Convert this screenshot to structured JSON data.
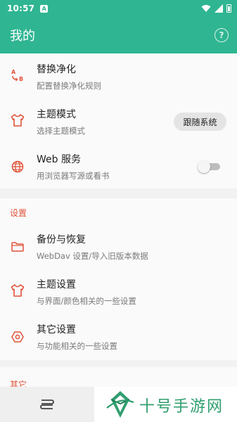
{
  "status_bar": {
    "time": "10:57",
    "notification_badge": "A"
  },
  "app_bar": {
    "title": "我的",
    "help_icon": "question-circle-icon"
  },
  "colors": {
    "primary": "#2fb592",
    "accent_red": "#e0533a",
    "watermark_green": "#2f9e6e"
  },
  "items_top": [
    {
      "title": "替换净化",
      "subtitle": "配置替换净化规则",
      "icon": "replace-ab-icon"
    },
    {
      "title": "主题模式",
      "subtitle": "选择主题模式",
      "icon": "tshirt-icon",
      "chip": "跟随系统"
    },
    {
      "title": "Web 服务",
      "subtitle": "用浏览器写源或看书",
      "icon": "globe-icon",
      "toggle_on": false
    }
  ],
  "settings": {
    "label": "设置",
    "items": [
      {
        "title": "备份与恢复",
        "subtitle": "WebDav 设置/导入旧版本数据",
        "icon": "folder-icon"
      },
      {
        "title": "主题设置",
        "subtitle": "与界面/颜色相关的一些设置",
        "icon": "tshirt-icon"
      },
      {
        "title": "其它设置",
        "subtitle": "与功能相关的一些设置",
        "icon": "settings-hexagon-icon"
      }
    ]
  },
  "other": {
    "label": "其它"
  },
  "bottom_nav": {
    "nav_icon": "bookshelf-nav-icon"
  },
  "watermark": {
    "text": "十号手游网"
  }
}
